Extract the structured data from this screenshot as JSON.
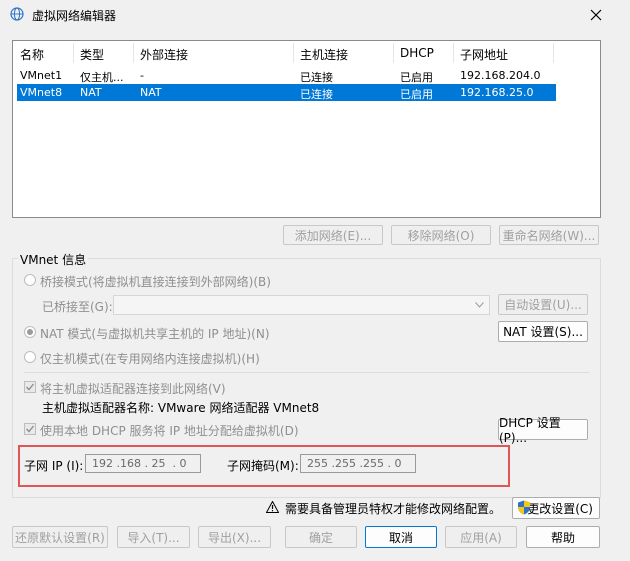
{
  "window": {
    "title": "虚拟网络编辑器"
  },
  "table": {
    "columns": [
      "名称",
      "类型",
      "外部连接",
      "主机连接",
      "DHCP",
      "子网地址"
    ],
    "rows": [
      [
        "VMnet1",
        "仅主机...",
        "-",
        "已连接",
        "已启用",
        "192.168.204.0"
      ],
      [
        "VMnet8",
        "NAT",
        "NAT",
        "已连接",
        "已启用",
        "192.168.25.0"
      ]
    ],
    "selected_row": 1
  },
  "list_buttons": {
    "add": "添加网络(E)...",
    "remove": "移除网络(O)",
    "rename": "重命名网络(W)..."
  },
  "vmnet_info": {
    "title": "VMnet 信息",
    "bridged_label": "桥接模式(将虚拟机直接连接到外部网络)(B)",
    "bridged_to_label": "已桥接至(G):",
    "bridged_to_value": "",
    "auto_settings": "自动设置(U)...",
    "nat_label": "NAT 模式(与虚拟机共享主机的 IP 地址)(N)",
    "nat_settings": "NAT 设置(S)...",
    "hostonly_label": "仅主机模式(在专用网络内连接虚拟机)(H)",
    "connect_adapter_label": "将主机虚拟适配器连接到此网络(V)",
    "adapter_name_label": "主机虚拟适配器名称: VMware 网络适配器 VMnet8",
    "dhcp_label": "使用本地 DHCP 服务将 IP 地址分配给虚拟机(D)",
    "dhcp_settings": "DHCP 设置(P)...",
    "selected_mode": "nat"
  },
  "subnet": {
    "ip_label": "子网 IP (I):",
    "ip_value": "192 .168 . 25  . 0",
    "mask_label": "子网掩码(M):",
    "mask_value": "255 .255 .255 . 0"
  },
  "admin_notice": {
    "text": "需要具备管理员特权才能修改网络配置。",
    "change_button": "更改设置(C)"
  },
  "footer": {
    "restore": "还原默认设置(R)",
    "import": "导入(T)...",
    "export": "导出(X)...",
    "ok": "确定",
    "cancel": "取消",
    "apply": "应用(A)",
    "help": "帮助"
  },
  "colors": {
    "selection": "#0078d7",
    "highlight_border": "#e05656",
    "shield_blue": "#2b74c7",
    "shield_yellow": "#f5c518"
  }
}
